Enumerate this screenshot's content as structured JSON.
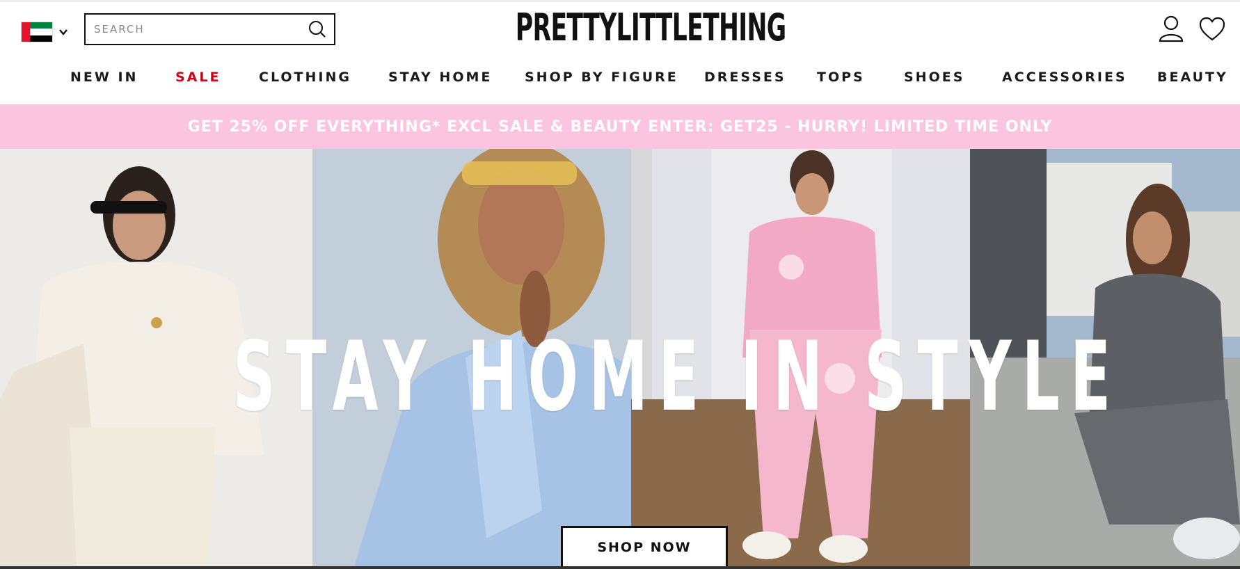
{
  "header": {
    "country": {
      "flag": "uae-flag-icon",
      "colors": {
        "red": "#e8112d",
        "green": "#00843d",
        "white": "#ffffff",
        "black": "#000000"
      }
    },
    "search": {
      "placeholder": "SEARCH",
      "icon": "search-icon"
    },
    "logo": "PRETTYLITTLETHING",
    "icons": {
      "account": "user-icon",
      "wishlist": "heart-icon"
    }
  },
  "nav": {
    "items": [
      {
        "label": "NEW IN"
      },
      {
        "label": "SALE"
      },
      {
        "label": "CLOTHING"
      },
      {
        "label": "STAY HOME"
      },
      {
        "label": "SHOP BY FIGURE"
      },
      {
        "label": "DRESSES"
      },
      {
        "label": "TOPS"
      },
      {
        "label": "SHOES"
      },
      {
        "label": "ACCESSORIES"
      },
      {
        "label": "BEAUTY"
      }
    ]
  },
  "promo": {
    "text": "GET 25% OFF EVERYTHING* EXCL SALE & BEAUTY ENTER: GET25 - HURRY! LIMITED TIME ONLY",
    "background": "#fbc4df"
  },
  "hero": {
    "title": "STAY HOME IN STYLE",
    "cta": "SHOP NOW"
  },
  "colors": {
    "sale": "#d0021b",
    "text": "#1a1a1a",
    "promo_bg": "#fbc4df"
  }
}
